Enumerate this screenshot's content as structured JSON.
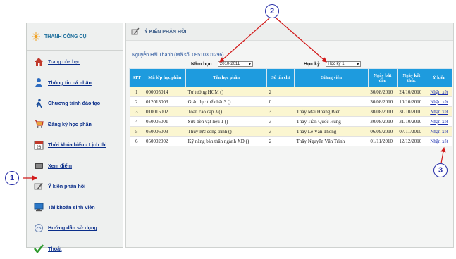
{
  "sidebar": {
    "title": "THANH CÔNG CỤ",
    "items": [
      {
        "label": "Trang của bạn",
        "icon": "home-icon"
      },
      {
        "label": "Thông tin cá nhân",
        "icon": "person-icon"
      },
      {
        "label": "Chương trình đào tạo",
        "icon": "runner-icon"
      },
      {
        "label": "Đăng ký học phần",
        "icon": "cart-icon"
      },
      {
        "label": "Thời khóa biểu - Lịch thi",
        "icon": "calendar-icon"
      },
      {
        "label": "Xem điểm",
        "icon": "scores-icon"
      },
      {
        "label": "Ý kiến phản hồi",
        "icon": "feedback-icon"
      },
      {
        "label": "Tài khoản sinh viên",
        "icon": "monitor-icon"
      },
      {
        "label": "Hướng dẫn sử dụng",
        "icon": "help-icon"
      },
      {
        "label": "Thoát",
        "icon": "checkmark-icon"
      }
    ]
  },
  "main": {
    "title": "Ý KIẾN PHẢN HỒI",
    "student": "Nguyễn Hải Thanh (Mã số: 09510301296)",
    "year_label": "Năm học:",
    "year_value": "2010-2011",
    "semester_label": "Học kỳ:",
    "semester_value": "Học kỳ 1"
  },
  "table": {
    "headers": [
      "STT",
      "Mã lớp học phần",
      "Tên học phần",
      "Số tín chỉ",
      "Giảng viên",
      "Ngày bắt đầu",
      "Ngày kết thúc",
      "Ý kiến"
    ],
    "rows": [
      [
        "1",
        "000005014",
        "Tư tưởng HCM ()",
        "2",
        "",
        "30/08/2010",
        "24/10/2010",
        "Nhận xét"
      ],
      [
        "2",
        "012013003",
        "Giáo dục thể chất 3 ()",
        "0",
        "",
        "30/08/2010",
        "10/10/2010",
        "Nhận xét"
      ],
      [
        "3",
        "010015002",
        "Toán cao cấp 3 ()",
        "3",
        "Thầy Mai Hoàng Biên",
        "30/08/2010",
        "31/10/2010",
        "Nhận xét"
      ],
      [
        "4",
        "050005001",
        "Sức bền vật liệu 1 ()",
        "3",
        "Thầy Trần Quốc Hùng",
        "30/08/2010",
        "31/10/2010",
        "Nhận xét"
      ],
      [
        "5",
        "050006003",
        "Thủy lực công trình ()",
        "3",
        "Thầy Lê Văn Thông",
        "06/09/2010",
        "07/11/2010",
        "Nhận xét"
      ],
      [
        "6",
        "050002002",
        "Kỹ năng bàn thân ngành XD ()",
        "2",
        "Thầy Nguyễn Văn Trình",
        "01/11/2010",
        "12/12/2010",
        "Nhận xét"
      ]
    ]
  },
  "callouts": [
    "1",
    "2",
    "3"
  ]
}
